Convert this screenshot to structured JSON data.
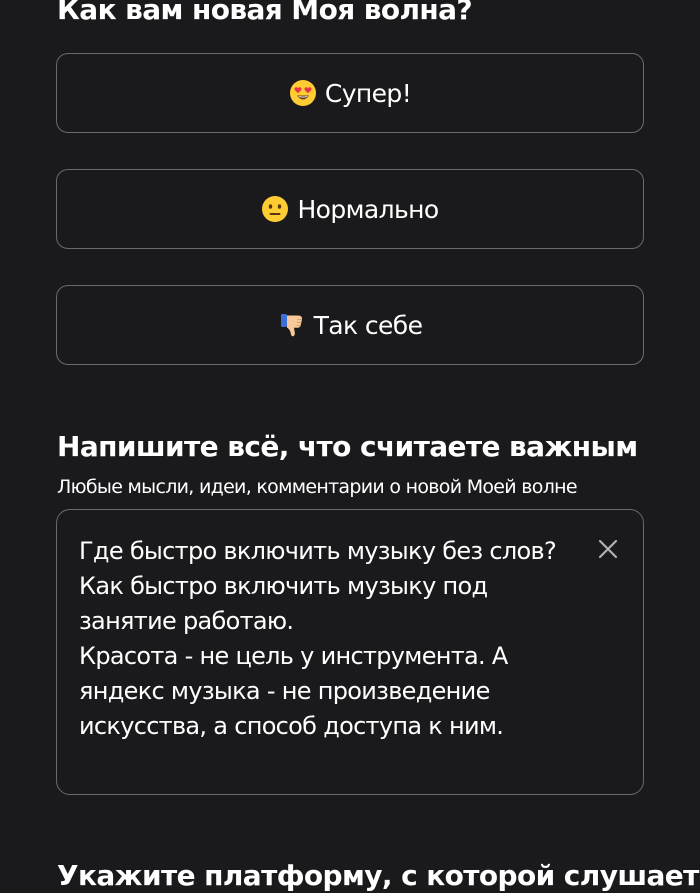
{
  "survey": {
    "question": "Как вам новая Моя волна?",
    "options": [
      {
        "emoji": "smiling-face-heart-eyes-icon",
        "label": "Супер!"
      },
      {
        "emoji": "neutral-face-icon",
        "label": "Нормально"
      },
      {
        "emoji": "thumbs-down-icon",
        "label": "Так себе"
      }
    ]
  },
  "feedback": {
    "title": "Напишите всё, что считаете важным",
    "subtitle": "Любые мысли, идеи, комментарии о новой Моей волне",
    "value": "Где быстро включить музыку без слов?\nКак быстро включить музыку под занятие работаю.\nКрасота - не цель у инструмента. А яндекс музыка - не произведение искусства, а способ доступа к ним.",
    "clear_icon": "close-icon"
  },
  "platform": {
    "title": "Укажите платформу, с которой слушаете"
  },
  "colors": {
    "background": "#1a1a1c",
    "border": "#6a6a6e",
    "text": "#ffffff",
    "emoji_yellow": "#ffcc33",
    "heart_red": "#e8344a"
  }
}
